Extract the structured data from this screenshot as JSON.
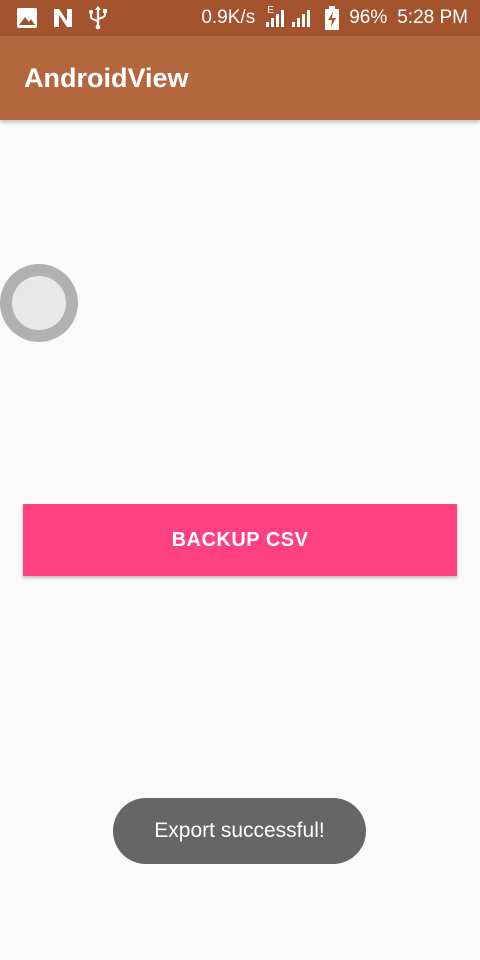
{
  "status_bar": {
    "network_speed": "0.9K/s",
    "network_type": "E",
    "battery_percent": "96%",
    "time": "5:28 PM",
    "icons": [
      "image-icon",
      "n-notification-icon",
      "usb-icon",
      "signal-icon",
      "battery-charging-icon"
    ]
  },
  "app_bar": {
    "title": "AndroidView"
  },
  "main": {
    "backup_button_label": "BACKUP CSV"
  },
  "toast": {
    "message": "Export successful!"
  },
  "colors": {
    "status_bar": "#a3542e",
    "app_bar": "#b4673f",
    "accent": "#ff4081",
    "toast_bg": "#666666",
    "background": "#fafafa"
  }
}
